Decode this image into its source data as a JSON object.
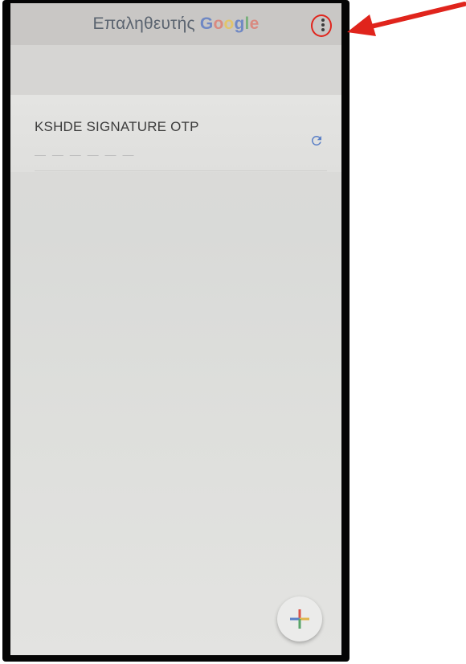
{
  "appbar": {
    "title_word": "Επαληθευτής",
    "title_brand": [
      "G",
      "o",
      "o",
      "g",
      "l",
      "e"
    ],
    "menu_icon": "more-vert-icon"
  },
  "accounts": [
    {
      "name": "KSHDE SIGNATURE OTP",
      "code": "— — — — — —",
      "refresh_icon": "refresh-icon"
    }
  ],
  "fab": {
    "icon": "add-icon"
  },
  "annotation": {
    "arrow_color": "#e0241c",
    "highlight": "menu-button"
  },
  "colors": {
    "frame": "#050505",
    "appbar": "#c9c7c5",
    "screen": "#dcdcda",
    "accent_blue": "#5a7fc6"
  }
}
